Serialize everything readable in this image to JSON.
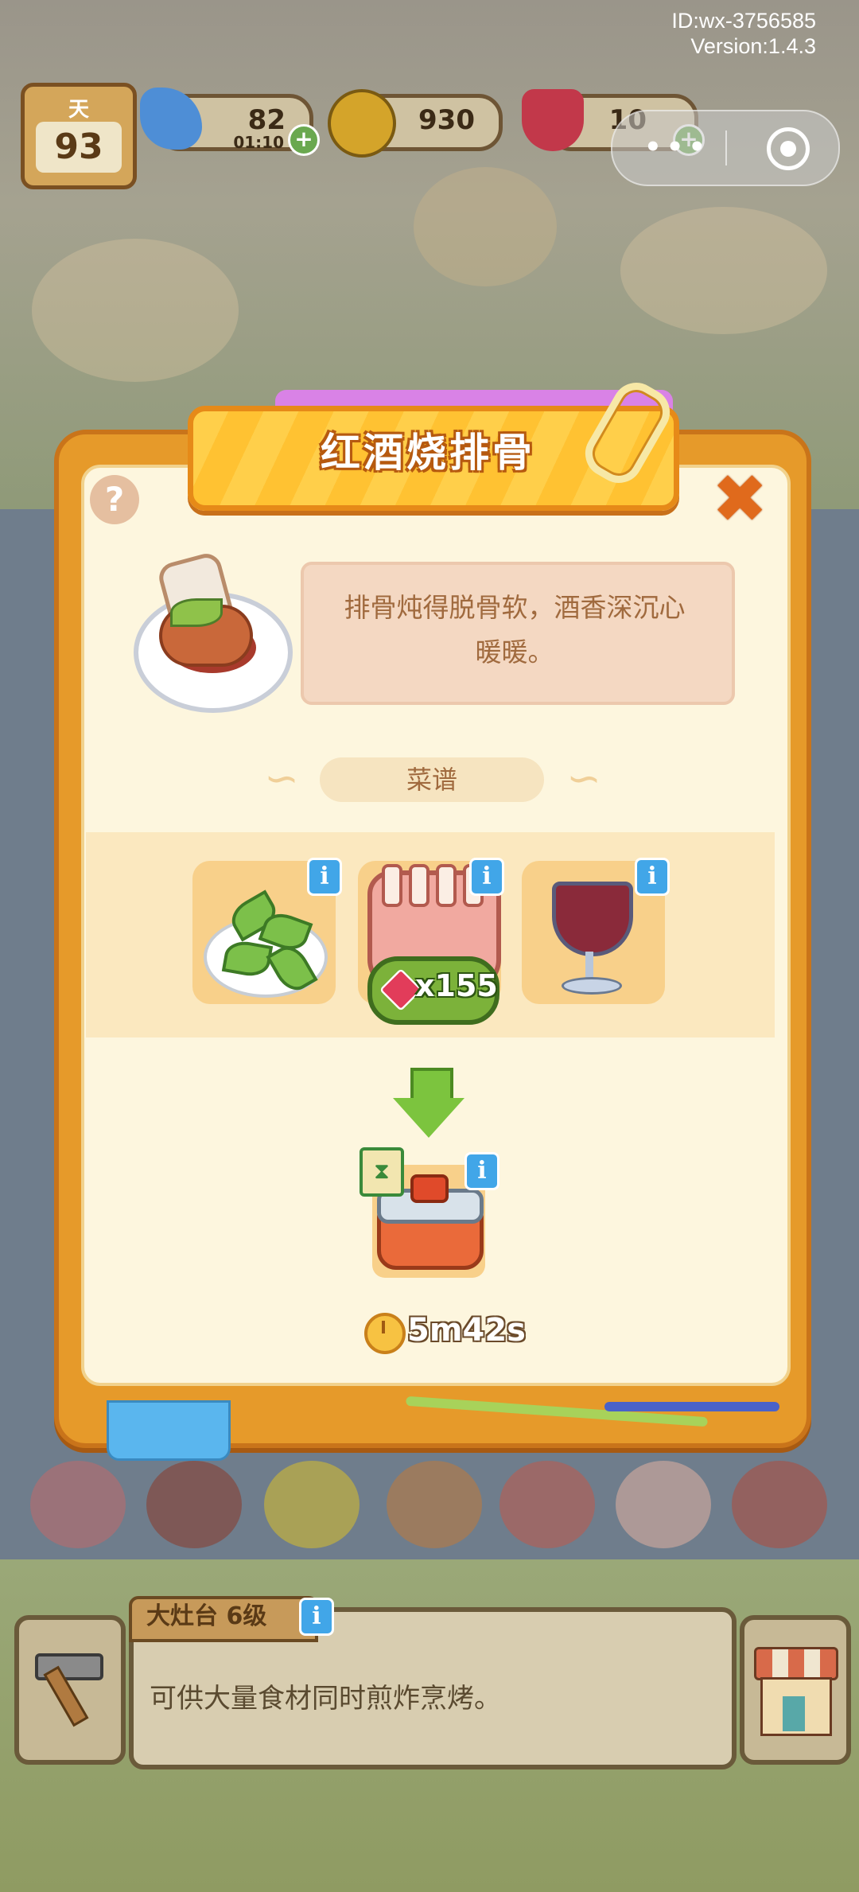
{
  "meta": {
    "id": "ID:wx-3756585",
    "version": "Version:1.4.3"
  },
  "hud": {
    "day_label": "天",
    "day_value": "93",
    "energy_value": "82",
    "energy_timer": "01:10",
    "coins_value": "930",
    "gems_value": "10",
    "plus_symbol": "+"
  },
  "capsule": {
    "more_icon": "•••",
    "close_icon": "target-icon"
  },
  "dialog": {
    "title": "红酒烧排骨",
    "help_symbol": "?",
    "close_symbol": "✖",
    "description": "排骨炖得脱骨软，酒香深沉心暖暖。",
    "recipe_label": "菜谱",
    "ingredients": [
      {
        "name": "herb-icon",
        "info": "i"
      },
      {
        "name": "ribs-icon",
        "info": "i",
        "price_symbol": "x155"
      },
      {
        "name": "red-wine-icon",
        "info": "i"
      }
    ],
    "result": {
      "name": "pot-icon",
      "info": "i"
    },
    "time": "5m42s"
  },
  "bottom": {
    "panel_title": "大灶台 6级",
    "panel_info": "i",
    "panel_text": "可供大量食材同时煎炸烹烤。"
  },
  "colors": {
    "accent": "#e69a2a",
    "title": "#ffc232",
    "price": "#7cb23a"
  }
}
